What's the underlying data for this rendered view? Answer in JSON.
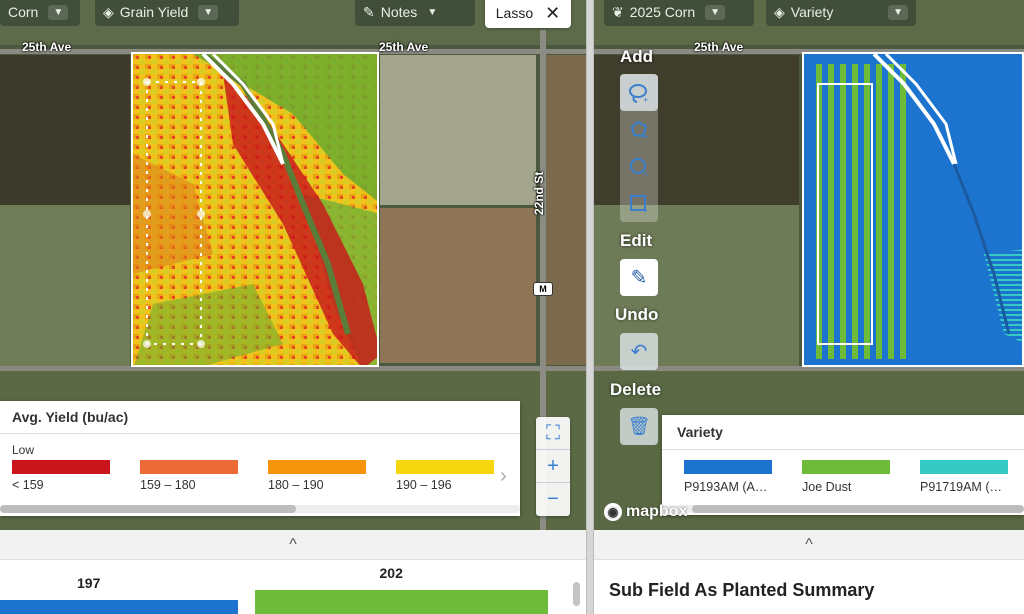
{
  "left_map": {
    "filters": {
      "crop": "Corn",
      "layer": "Grain Yield",
      "notes": "Notes",
      "tool": "Lasso"
    },
    "roads": {
      "top": "25th Ave",
      "vertical": "22nd St",
      "marker": "M"
    }
  },
  "yield_legend": {
    "title": "Avg. Yield (bu/ac)",
    "low_label": "Low",
    "items": [
      {
        "label": "< 159",
        "color": "#c8141a"
      },
      {
        "label": "159 – 180",
        "color": "#ec6a35"
      },
      {
        "label": "180 – 190",
        "color": "#f5930a"
      },
      {
        "label": "190 – 196",
        "color": "#f6d70f"
      }
    ],
    "next_arrow": "›"
  },
  "zoom": {
    "fit": "⛶",
    "in": "+",
    "out": "−"
  },
  "right_map": {
    "filters": {
      "season": "2025 Corn",
      "layer": "Variety"
    },
    "road_top": "25th Ave",
    "tools": {
      "add": "Add",
      "edit": "Edit",
      "undo": "Undo",
      "delete": "Delete"
    },
    "attribution": "mapbox"
  },
  "variety_legend": {
    "title": "Variety",
    "items": [
      {
        "label": "P9193AM (A…",
        "color": "#1d74cf"
      },
      {
        "label": "Joe Dust",
        "color": "#6dbb38"
      },
      {
        "label": "P91719AM (…",
        "color": "#35cbc4"
      }
    ]
  },
  "chart_data": {
    "type": "bar",
    "values": [
      197,
      202
    ],
    "colors": [
      "#1d74cf",
      "#6dbb38"
    ]
  },
  "summary": {
    "title": "Sub Field As Planted Summary",
    "collapse_icon": "^"
  }
}
